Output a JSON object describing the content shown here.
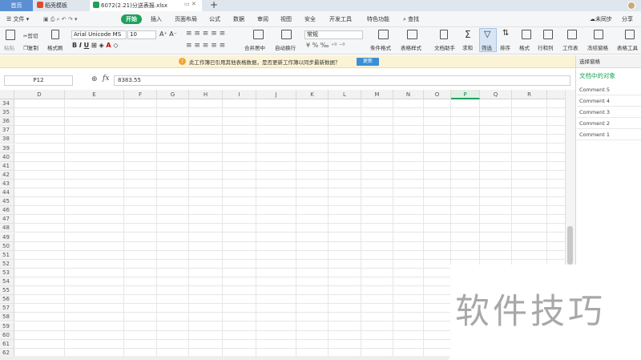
{
  "titlebar": {
    "home_tab": "首页",
    "template_tab": "稻壳模板",
    "file_tab": "6072(2.21)分送表报.xlsx"
  },
  "menu": {
    "file": "文件",
    "items": [
      "开始",
      "插入",
      "页面布局",
      "公式",
      "数据",
      "审阅",
      "视图",
      "安全",
      "开发工具",
      "特色功能"
    ],
    "search": "查找",
    "unsync": "未同步",
    "share": "分享"
  },
  "ribbon": {
    "cut": "剪切",
    "paste": "粘贴",
    "copy": "复制",
    "format_painter": "格式刷",
    "font_name": "Arial Unicode MS",
    "font_size": "10",
    "merge": "合并居中",
    "wrap": "自动换行",
    "number_format": "常规",
    "cond_format": "条件格式",
    "table_style": "表格样式",
    "doc_helper": "文档助手",
    "sum": "求和",
    "filter": "筛选",
    "sort": "排序",
    "format": "格式",
    "row_col": "行和列",
    "sheet": "工作表",
    "freeze": "冻结窗格",
    "table_tool": "表格工具"
  },
  "notice": {
    "text": "此工作簿已引用其他表格数据，是否更新工作簿以同步最新数据？",
    "button": "更新"
  },
  "formula": {
    "cell_ref": "P12",
    "fx": "fx",
    "value": "8383.55"
  },
  "columns": [
    "D",
    "E",
    "F",
    "G",
    "H",
    "I",
    "J",
    "K",
    "L",
    "M",
    "N",
    "O",
    "P",
    "Q",
    "R"
  ],
  "active_column": "P",
  "rows": [
    "34",
    "35",
    "36",
    "37",
    "38",
    "39",
    "40",
    "41",
    "42",
    "43",
    "44",
    "45",
    "46",
    "47",
    "48",
    "49",
    "50",
    "51",
    "52",
    "53",
    "54",
    "55",
    "56",
    "57",
    "58",
    "59",
    "60",
    "61",
    "62"
  ],
  "side_panel": {
    "header": "选择窗格",
    "title": "文档中的对象",
    "items": [
      "Comment 5",
      "Comment 4",
      "Comment 3",
      "Comment 2",
      "Comment 1"
    ]
  },
  "watermark": "软件技巧",
  "colors": {
    "accent": "#1fa15c",
    "home_tab": "#5b8fd4",
    "notice_bg": "#fbf3d6",
    "update_btn": "#3b8fd9"
  }
}
